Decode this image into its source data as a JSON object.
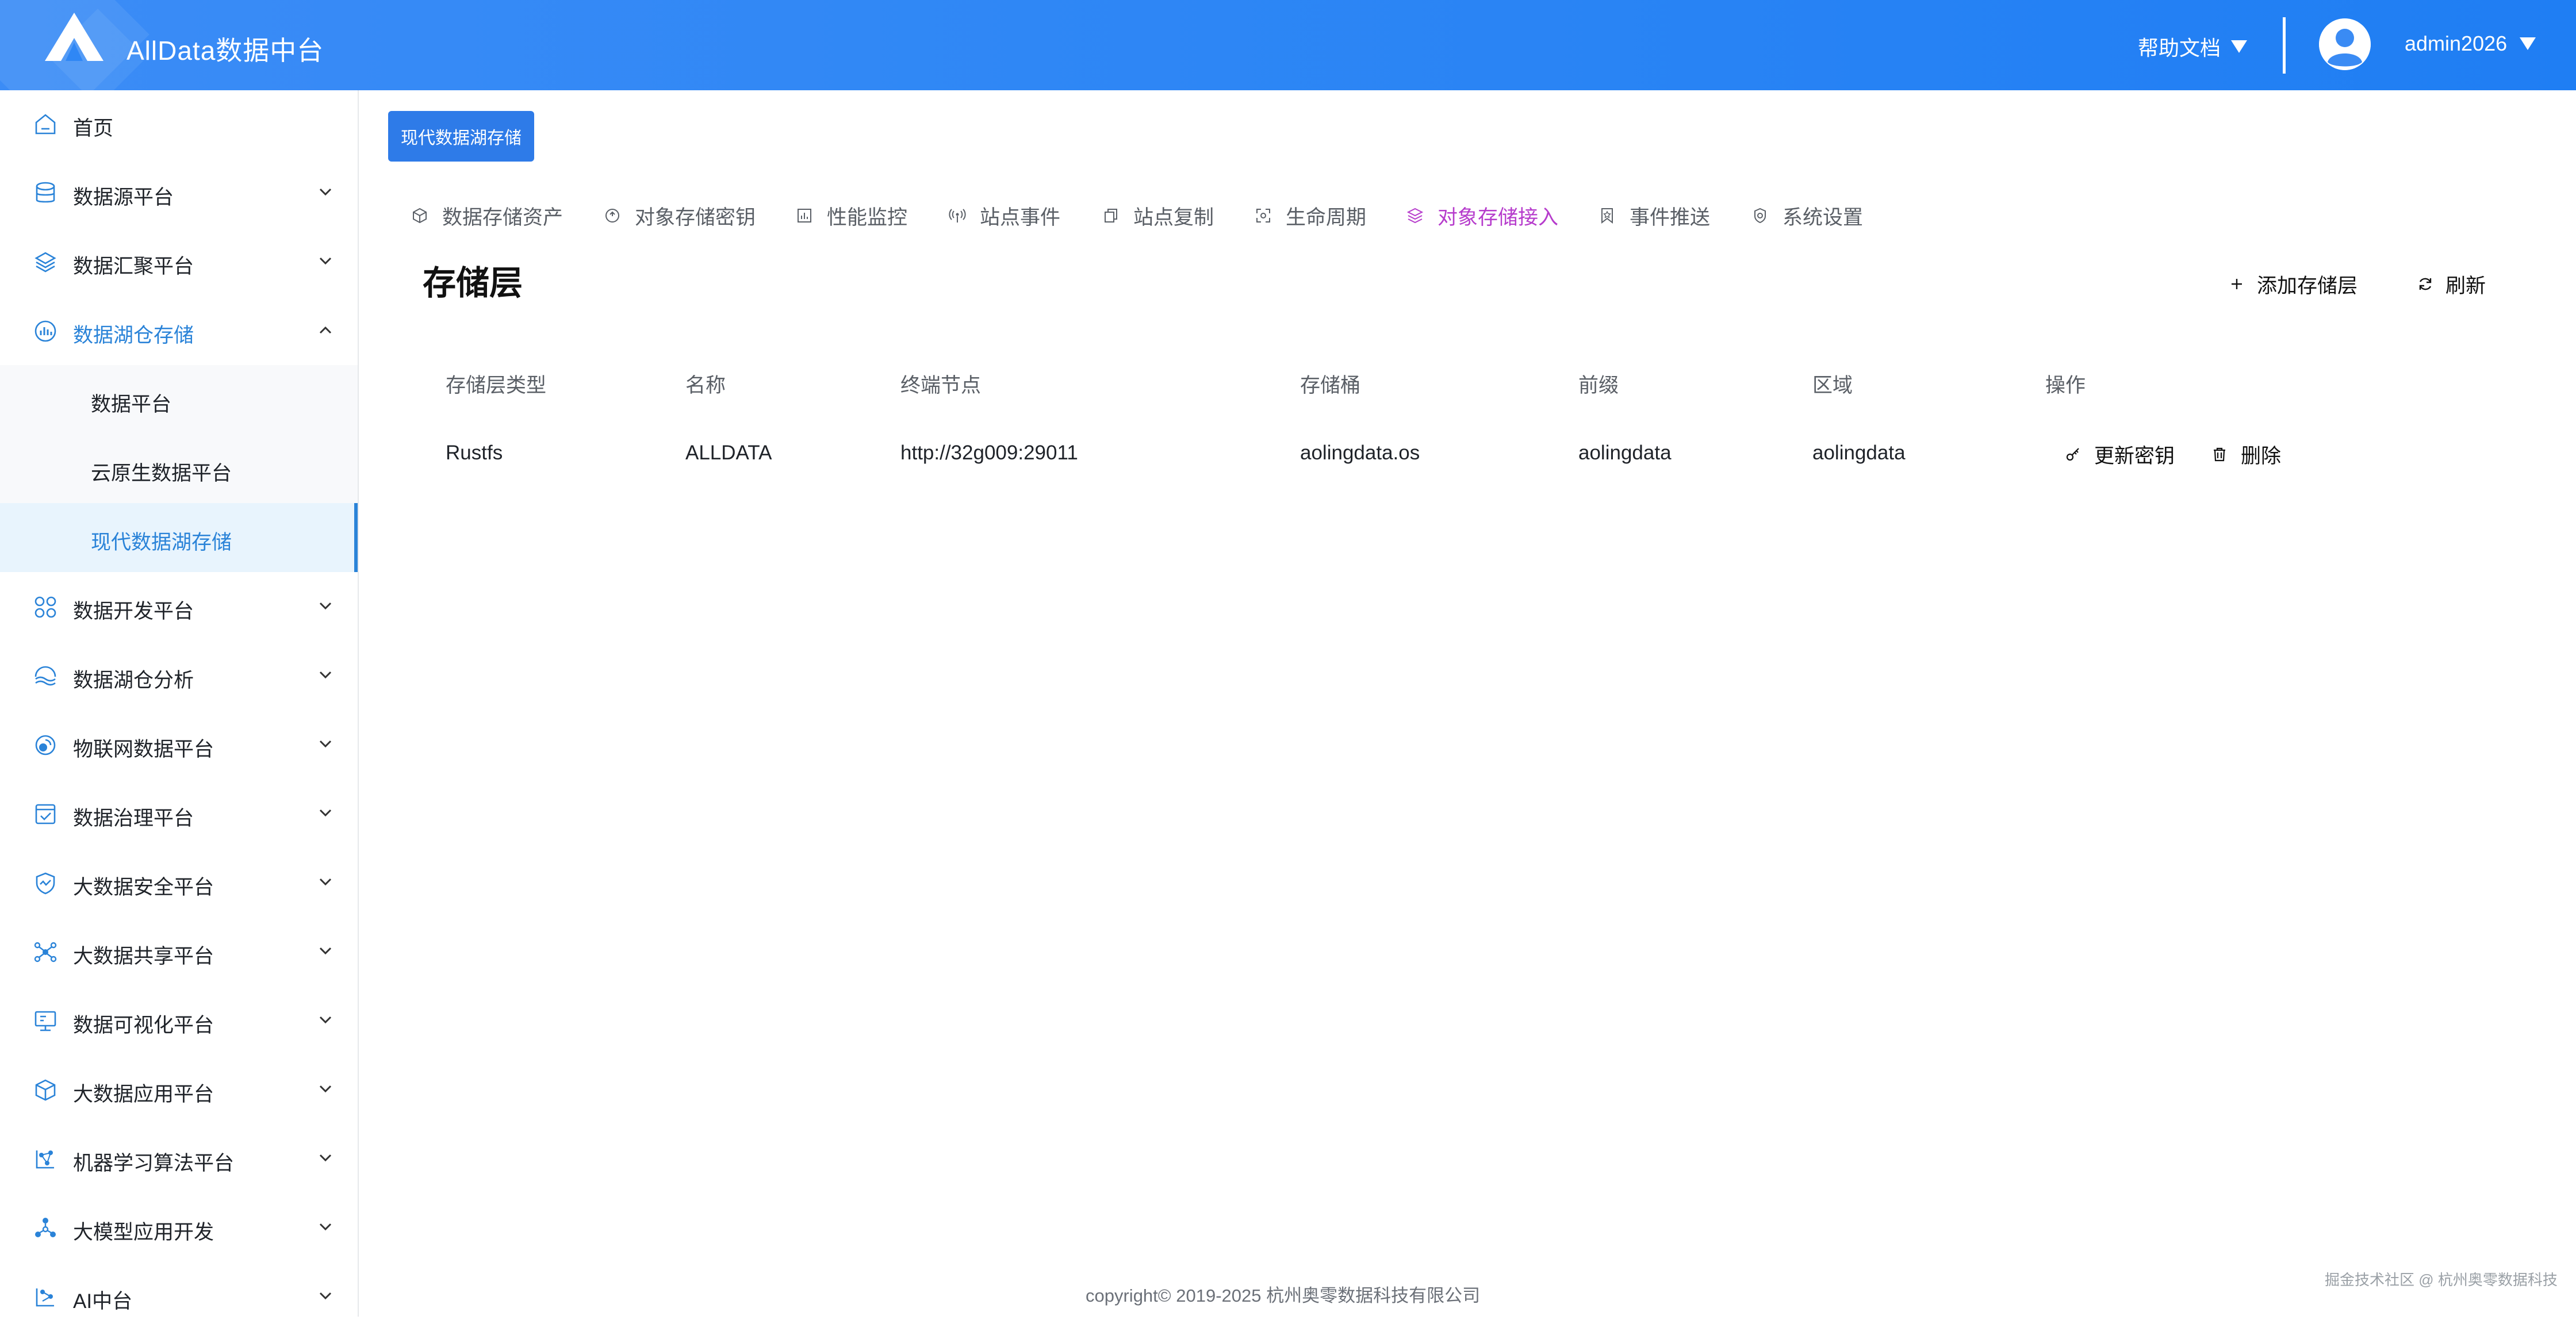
{
  "header": {
    "app_title": "AllData数据中台",
    "help_label": "帮助文档",
    "user_name": "admin2026"
  },
  "sidebar": {
    "items": [
      {
        "label": "首页",
        "icon": "home-icon"
      },
      {
        "label": "数据源平台",
        "icon": "database-icon"
      },
      {
        "label": "数据汇聚平台",
        "icon": "layers-icon"
      },
      {
        "label": "数据湖仓存储",
        "icon": "lake-storage-icon",
        "expanded": true
      },
      {
        "label": "数据开发平台",
        "icon": "grid-circles-icon"
      },
      {
        "label": "数据湖仓分析",
        "icon": "waves-icon"
      },
      {
        "label": "物联网数据平台",
        "icon": "iot-icon"
      },
      {
        "label": "数据治理平台",
        "icon": "checklist-icon"
      },
      {
        "label": "大数据安全平台",
        "icon": "shield-icon"
      },
      {
        "label": "大数据共享平台",
        "icon": "share-nodes-icon"
      },
      {
        "label": "数据可视化平台",
        "icon": "monitor-icon"
      },
      {
        "label": "大数据应用平台",
        "icon": "cube-icon"
      },
      {
        "label": "机器学习算法平台",
        "icon": "ml-graph-icon"
      },
      {
        "label": "大模型应用开发",
        "icon": "molecule-icon"
      },
      {
        "label": "AI中台",
        "icon": "ai-graph-icon"
      }
    ],
    "sub_items": [
      {
        "label": "数据平台"
      },
      {
        "label": "云原生数据平台"
      },
      {
        "label": "现代数据湖存储",
        "selected": true
      }
    ]
  },
  "main": {
    "tag_label": "现代数据湖存储",
    "tabs": [
      {
        "label": "数据存储资产",
        "icon": "box-icon"
      },
      {
        "label": "对象存储密钥",
        "icon": "key-circle-icon"
      },
      {
        "label": "性能监控",
        "icon": "bar-chart-icon"
      },
      {
        "label": "站点事件",
        "icon": "broadcast-icon"
      },
      {
        "label": "站点复制",
        "icon": "copy-icon"
      },
      {
        "label": "生命周期",
        "icon": "lifecycle-icon"
      },
      {
        "label": "对象存储接入",
        "icon": "stack-icon",
        "active": true
      },
      {
        "label": "事件推送",
        "icon": "bookmark-icon"
      },
      {
        "label": "系统设置",
        "icon": "settings-icon"
      }
    ],
    "heading": "存储层",
    "add_label": "添加存储层",
    "refresh_label": "刷新",
    "table": {
      "columns": [
        "存储层类型",
        "名称",
        "终端节点",
        "存储桶",
        "前缀",
        "区域",
        "操作"
      ],
      "rows": [
        {
          "type": "Rustfs",
          "name": "ALLDATA",
          "endpoint": "http://32g009:29011",
          "bucket": "aolingdata.os",
          "prefix": "aolingdata",
          "region": "aolingdata",
          "update_key_label": "更新密钥",
          "delete_label": "删除"
        }
      ]
    }
  },
  "footer": {
    "copyright": "copyright© 2019-2025 杭州奥零数据科技有限公司",
    "watermark": "掘金技术社区 @ 杭州奥零数据科技"
  },
  "colors": {
    "header_blue": "#2f87f5",
    "sidebar_active": "#2a83d8",
    "tab_active": "#b63ccc",
    "tag_button": "#2e7be8"
  }
}
